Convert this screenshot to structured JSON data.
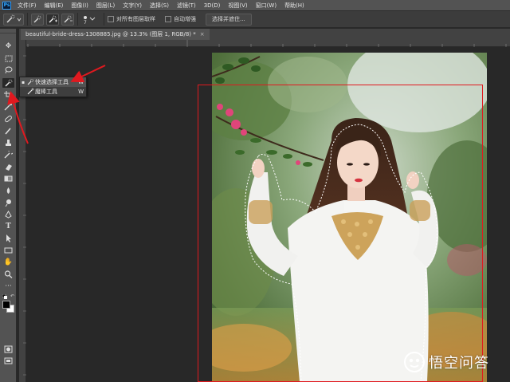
{
  "app": {
    "logo_text": "Ps"
  },
  "menubar": {
    "items": [
      "文件(F)",
      "编辑(E)",
      "图像(I)",
      "图层(L)",
      "文字(Y)",
      "选择(S)",
      "滤镜(T)",
      "3D(D)",
      "视图(V)",
      "窗口(W)",
      "帮助(H)"
    ]
  },
  "options": {
    "brush_size": "7",
    "sample_all_layers_label": "对所有图层取样",
    "auto_enhance_label": "自动增强",
    "select_and_mask_label": "选择并遮住..."
  },
  "document": {
    "tab_title": "beautiful-bride-dress-1308885.jpg @ 13.3% (图层 1, RGB/8) *",
    "close_glyph": "×"
  },
  "flyout": {
    "items": [
      {
        "label": "快速选择工具",
        "shortcut": "W",
        "selected": true
      },
      {
        "label": "魔棒工具",
        "shortcut": "W",
        "selected": false
      }
    ]
  },
  "watermark": {
    "text": "悟空问答"
  },
  "colors": {
    "annotation_red": "#e0191f",
    "ps_blue": "#31a8ff",
    "dress_white": "#f4f4f2"
  }
}
